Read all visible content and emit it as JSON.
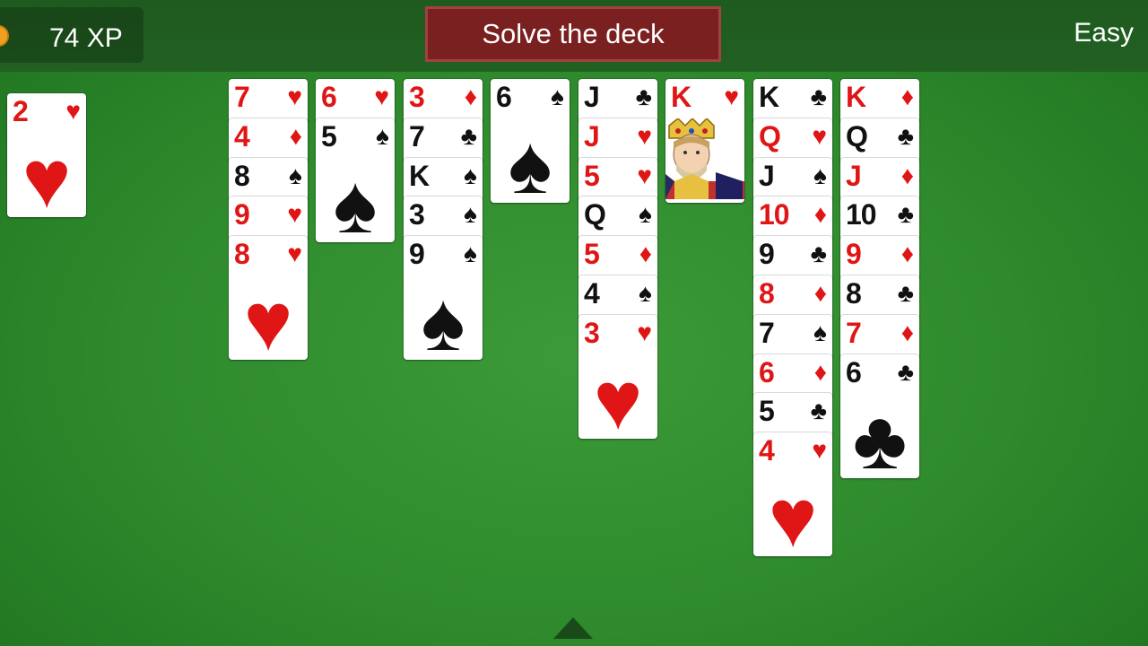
{
  "header": {
    "xp": "74 XP",
    "goal": "Solve the deck",
    "difficulty": "Easy"
  },
  "foundation": [
    {
      "rank": "2",
      "suit": "hearts"
    }
  ],
  "tableau": [
    {
      "cards": []
    },
    {
      "cards": []
    },
    {
      "cards": [
        {
          "rank": "7",
          "suit": "hearts"
        },
        {
          "rank": "4",
          "suit": "diamonds"
        },
        {
          "rank": "8",
          "suit": "spades"
        },
        {
          "rank": "9",
          "suit": "hearts"
        },
        {
          "rank": "8",
          "suit": "hearts"
        }
      ]
    },
    {
      "cards": [
        {
          "rank": "6",
          "suit": "hearts"
        },
        {
          "rank": "5",
          "suit": "spades"
        }
      ]
    },
    {
      "cards": [
        {
          "rank": "3",
          "suit": "diamonds"
        },
        {
          "rank": "7",
          "suit": "clubs"
        },
        {
          "rank": "K",
          "suit": "spades"
        },
        {
          "rank": "3",
          "suit": "spades"
        },
        {
          "rank": "9",
          "suit": "spades"
        }
      ]
    },
    {
      "cards": [
        {
          "rank": "6",
          "suit": "spades"
        }
      ]
    },
    {
      "cards": [
        {
          "rank": "J",
          "suit": "clubs"
        },
        {
          "rank": "J",
          "suit": "hearts"
        },
        {
          "rank": "5",
          "suit": "hearts"
        },
        {
          "rank": "Q",
          "suit": "spades"
        },
        {
          "rank": "5",
          "suit": "diamonds"
        },
        {
          "rank": "4",
          "suit": "spades"
        },
        {
          "rank": "3",
          "suit": "hearts"
        }
      ]
    },
    {
      "cards": [
        {
          "rank": "K",
          "suit": "hearts"
        }
      ]
    },
    {
      "cards": [
        {
          "rank": "K",
          "suit": "clubs"
        },
        {
          "rank": "Q",
          "suit": "hearts"
        },
        {
          "rank": "J",
          "suit": "spades"
        },
        {
          "rank": "10",
          "suit": "diamonds"
        },
        {
          "rank": "9",
          "suit": "clubs"
        },
        {
          "rank": "8",
          "suit": "diamonds"
        },
        {
          "rank": "7",
          "suit": "spades"
        },
        {
          "rank": "6",
          "suit": "diamonds"
        },
        {
          "rank": "5",
          "suit": "clubs"
        },
        {
          "rank": "4",
          "suit": "hearts"
        }
      ]
    },
    {
      "cards": [
        {
          "rank": "K",
          "suit": "diamonds"
        },
        {
          "rank": "Q",
          "suit": "clubs"
        },
        {
          "rank": "J",
          "suit": "diamonds"
        },
        {
          "rank": "10",
          "suit": "clubs"
        },
        {
          "rank": "9",
          "suit": "diamonds"
        },
        {
          "rank": "8",
          "suit": "clubs"
        },
        {
          "rank": "7",
          "suit": "diamonds"
        },
        {
          "rank": "6",
          "suit": "clubs"
        }
      ]
    }
  ],
  "colors": {
    "felt": "#2e8a2c",
    "red_suit": "#e01515",
    "goal_bg": "#7a2020"
  }
}
